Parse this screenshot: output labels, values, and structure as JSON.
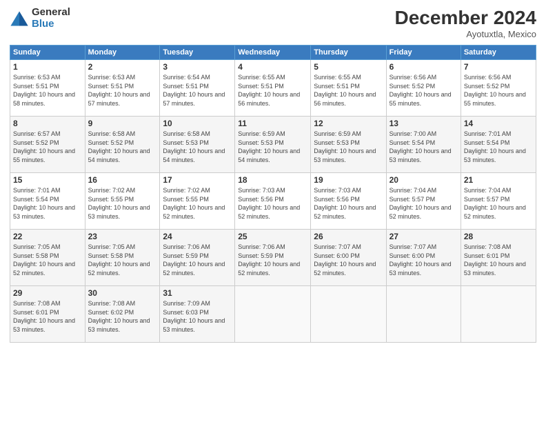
{
  "logo": {
    "general": "General",
    "blue": "Blue"
  },
  "title": "December 2024",
  "location": "Ayotuxtla, Mexico",
  "days_of_week": [
    "Sunday",
    "Monday",
    "Tuesday",
    "Wednesday",
    "Thursday",
    "Friday",
    "Saturday"
  ],
  "weeks": [
    [
      {
        "day": "1",
        "sunrise": "6:53 AM",
        "sunset": "5:51 PM",
        "daylight": "10 hours and 58 minutes."
      },
      {
        "day": "2",
        "sunrise": "6:53 AM",
        "sunset": "5:51 PM",
        "daylight": "10 hours and 57 minutes."
      },
      {
        "day": "3",
        "sunrise": "6:54 AM",
        "sunset": "5:51 PM",
        "daylight": "10 hours and 57 minutes."
      },
      {
        "day": "4",
        "sunrise": "6:55 AM",
        "sunset": "5:51 PM",
        "daylight": "10 hours and 56 minutes."
      },
      {
        "day": "5",
        "sunrise": "6:55 AM",
        "sunset": "5:51 PM",
        "daylight": "10 hours and 56 minutes."
      },
      {
        "day": "6",
        "sunrise": "6:56 AM",
        "sunset": "5:52 PM",
        "daylight": "10 hours and 55 minutes."
      },
      {
        "day": "7",
        "sunrise": "6:56 AM",
        "sunset": "5:52 PM",
        "daylight": "10 hours and 55 minutes."
      }
    ],
    [
      {
        "day": "8",
        "sunrise": "6:57 AM",
        "sunset": "5:52 PM",
        "daylight": "10 hours and 55 minutes."
      },
      {
        "day": "9",
        "sunrise": "6:58 AM",
        "sunset": "5:52 PM",
        "daylight": "10 hours and 54 minutes."
      },
      {
        "day": "10",
        "sunrise": "6:58 AM",
        "sunset": "5:53 PM",
        "daylight": "10 hours and 54 minutes."
      },
      {
        "day": "11",
        "sunrise": "6:59 AM",
        "sunset": "5:53 PM",
        "daylight": "10 hours and 54 minutes."
      },
      {
        "day": "12",
        "sunrise": "6:59 AM",
        "sunset": "5:53 PM",
        "daylight": "10 hours and 53 minutes."
      },
      {
        "day": "13",
        "sunrise": "7:00 AM",
        "sunset": "5:54 PM",
        "daylight": "10 hours and 53 minutes."
      },
      {
        "day": "14",
        "sunrise": "7:01 AM",
        "sunset": "5:54 PM",
        "daylight": "10 hours and 53 minutes."
      }
    ],
    [
      {
        "day": "15",
        "sunrise": "7:01 AM",
        "sunset": "5:54 PM",
        "daylight": "10 hours and 53 minutes."
      },
      {
        "day": "16",
        "sunrise": "7:02 AM",
        "sunset": "5:55 PM",
        "daylight": "10 hours and 53 minutes."
      },
      {
        "day": "17",
        "sunrise": "7:02 AM",
        "sunset": "5:55 PM",
        "daylight": "10 hours and 52 minutes."
      },
      {
        "day": "18",
        "sunrise": "7:03 AM",
        "sunset": "5:56 PM",
        "daylight": "10 hours and 52 minutes."
      },
      {
        "day": "19",
        "sunrise": "7:03 AM",
        "sunset": "5:56 PM",
        "daylight": "10 hours and 52 minutes."
      },
      {
        "day": "20",
        "sunrise": "7:04 AM",
        "sunset": "5:57 PM",
        "daylight": "10 hours and 52 minutes."
      },
      {
        "day": "21",
        "sunrise": "7:04 AM",
        "sunset": "5:57 PM",
        "daylight": "10 hours and 52 minutes."
      }
    ],
    [
      {
        "day": "22",
        "sunrise": "7:05 AM",
        "sunset": "5:58 PM",
        "daylight": "10 hours and 52 minutes."
      },
      {
        "day": "23",
        "sunrise": "7:05 AM",
        "sunset": "5:58 PM",
        "daylight": "10 hours and 52 minutes."
      },
      {
        "day": "24",
        "sunrise": "7:06 AM",
        "sunset": "5:59 PM",
        "daylight": "10 hours and 52 minutes."
      },
      {
        "day": "25",
        "sunrise": "7:06 AM",
        "sunset": "5:59 PM",
        "daylight": "10 hours and 52 minutes."
      },
      {
        "day": "26",
        "sunrise": "7:07 AM",
        "sunset": "6:00 PM",
        "daylight": "10 hours and 52 minutes."
      },
      {
        "day": "27",
        "sunrise": "7:07 AM",
        "sunset": "6:00 PM",
        "daylight": "10 hours and 53 minutes."
      },
      {
        "day": "28",
        "sunrise": "7:08 AM",
        "sunset": "6:01 PM",
        "daylight": "10 hours and 53 minutes."
      }
    ],
    [
      {
        "day": "29",
        "sunrise": "7:08 AM",
        "sunset": "6:01 PM",
        "daylight": "10 hours and 53 minutes."
      },
      {
        "day": "30",
        "sunrise": "7:08 AM",
        "sunset": "6:02 PM",
        "daylight": "10 hours and 53 minutes."
      },
      {
        "day": "31",
        "sunrise": "7:09 AM",
        "sunset": "6:03 PM",
        "daylight": "10 hours and 53 minutes."
      },
      null,
      null,
      null,
      null
    ]
  ]
}
